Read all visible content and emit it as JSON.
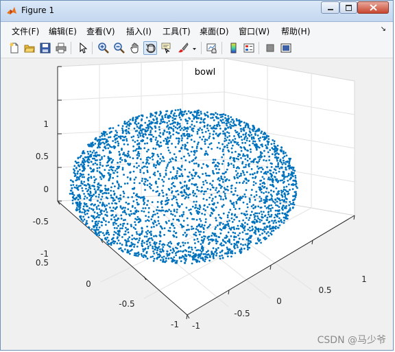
{
  "window": {
    "title": "Figure 1"
  },
  "menu": [
    "文件(F)",
    "编辑(E)",
    "查看(V)",
    "插入(I)",
    "工具(T)",
    "桌面(D)",
    "窗口(W)",
    "帮助(H)"
  ],
  "toolbar": [
    "new-figure-icon",
    "open-file-icon",
    "save-icon",
    "print-icon",
    "pointer-icon",
    "zoom-in-icon",
    "zoom-out-icon",
    "pan-hand-icon",
    "rotate-3d-icon",
    "data-cursor-icon",
    "brush-icon",
    "brush-dropdown-icon",
    "link-plot-icon",
    "colorbar-icon",
    "legend-icon",
    "hide-plot-tools-icon",
    "show-plot-tools-icon"
  ],
  "plot": {
    "title": "bowl",
    "z_ticks": [
      "1",
      "0.5",
      "0",
      "-0.5",
      "-1"
    ],
    "y_ticks": [
      "0.5",
      "0",
      "-0.5",
      "-1"
    ],
    "x_ticks": [
      "-1",
      "-0.5",
      "0",
      "0.5",
      "1"
    ],
    "marker_color": "#0072bd"
  },
  "chart_data": {
    "type": "scatter",
    "title": "bowl",
    "xlim": [
      -1,
      1
    ],
    "ylim": [
      -1,
      0.5
    ],
    "zlim": [
      -1,
      1
    ],
    "marker_color": "#0072bd",
    "grid": true,
    "legend": "none"
  },
  "watermark": "CSDN @马少爷"
}
